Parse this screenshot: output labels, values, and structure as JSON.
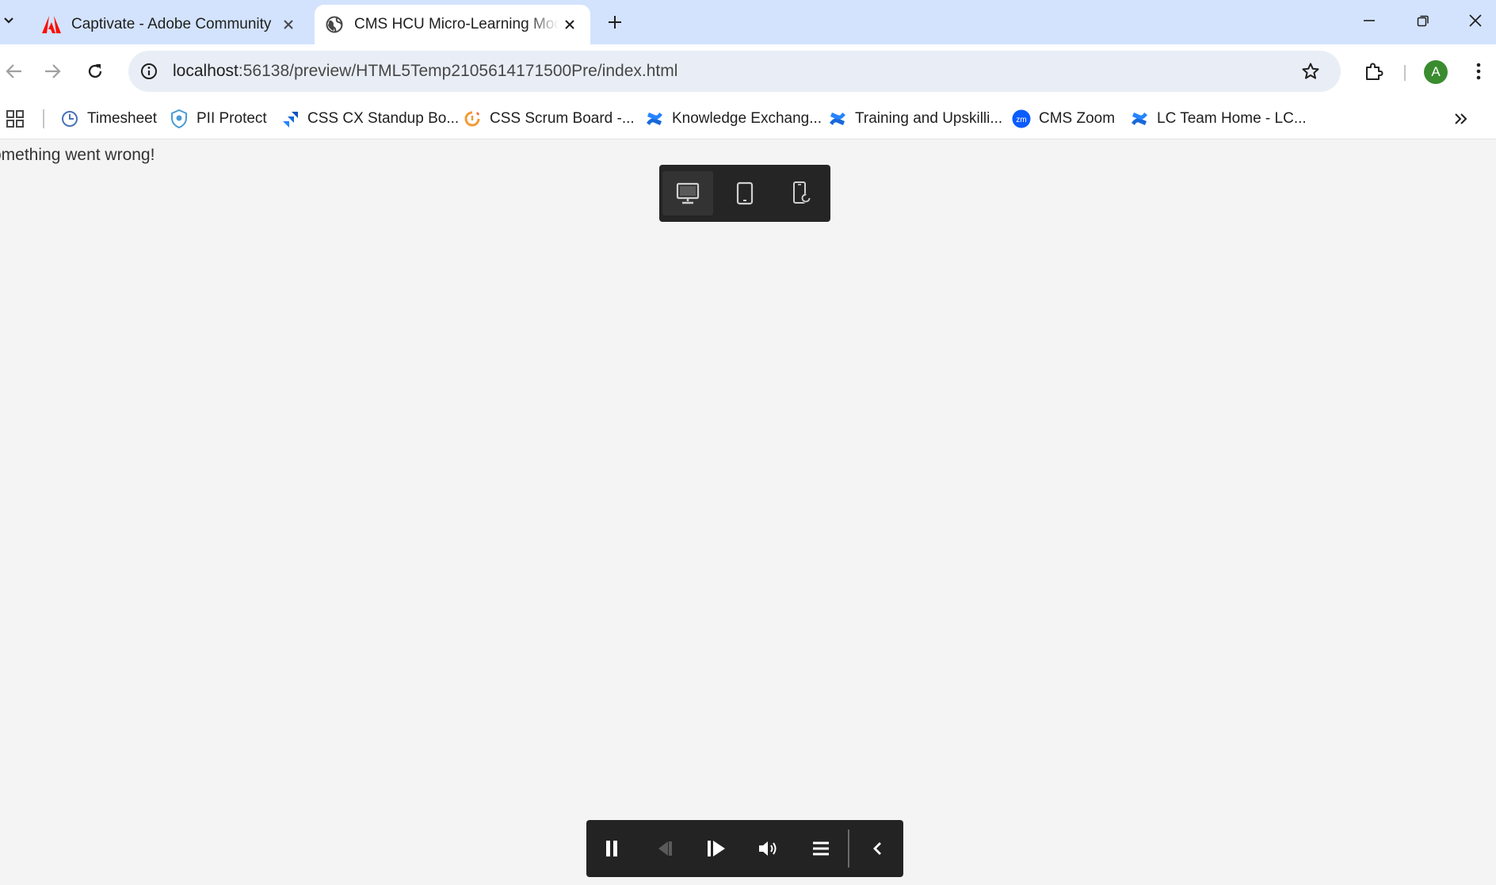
{
  "tabs": [
    {
      "title": "Captivate - Adobe Community",
      "favicon": "adobe-icon",
      "active": false
    },
    {
      "title": "CMS HCU Micro-Learning Mod",
      "favicon": "globe-icon",
      "active": true
    }
  ],
  "toolbar": {
    "url_host": "localhost",
    "url_path": ":56138/preview/HTML5Temp2105614171500Pre/index.html",
    "avatar_letter": "A"
  },
  "bookmarks": [
    {
      "label": "Timesheet",
      "icon": "clock-icon"
    },
    {
      "label": "PII Protect",
      "icon": "shield-icon"
    },
    {
      "label": "CSS CX Standup Bo...",
      "icon": "jira-icon"
    },
    {
      "label": "CSS Scrum Board -...",
      "icon": "scrum-icon"
    },
    {
      "label": "Knowledge Exchang...",
      "icon": "confluence-icon"
    },
    {
      "label": "Training and Upskilli...",
      "icon": "confluence-icon"
    },
    {
      "label": "CMS Zoom",
      "icon": "zoom-icon"
    },
    {
      "label": "LC Team Home - LC...",
      "icon": "confluence-icon"
    }
  ],
  "content": {
    "error_message": "omething went wrong!"
  },
  "colors": {
    "tabstrip": "#d3e3fd",
    "page_bg": "#f4f4f4",
    "player_bar": "#232323",
    "avatar": "#3a8c2f"
  }
}
